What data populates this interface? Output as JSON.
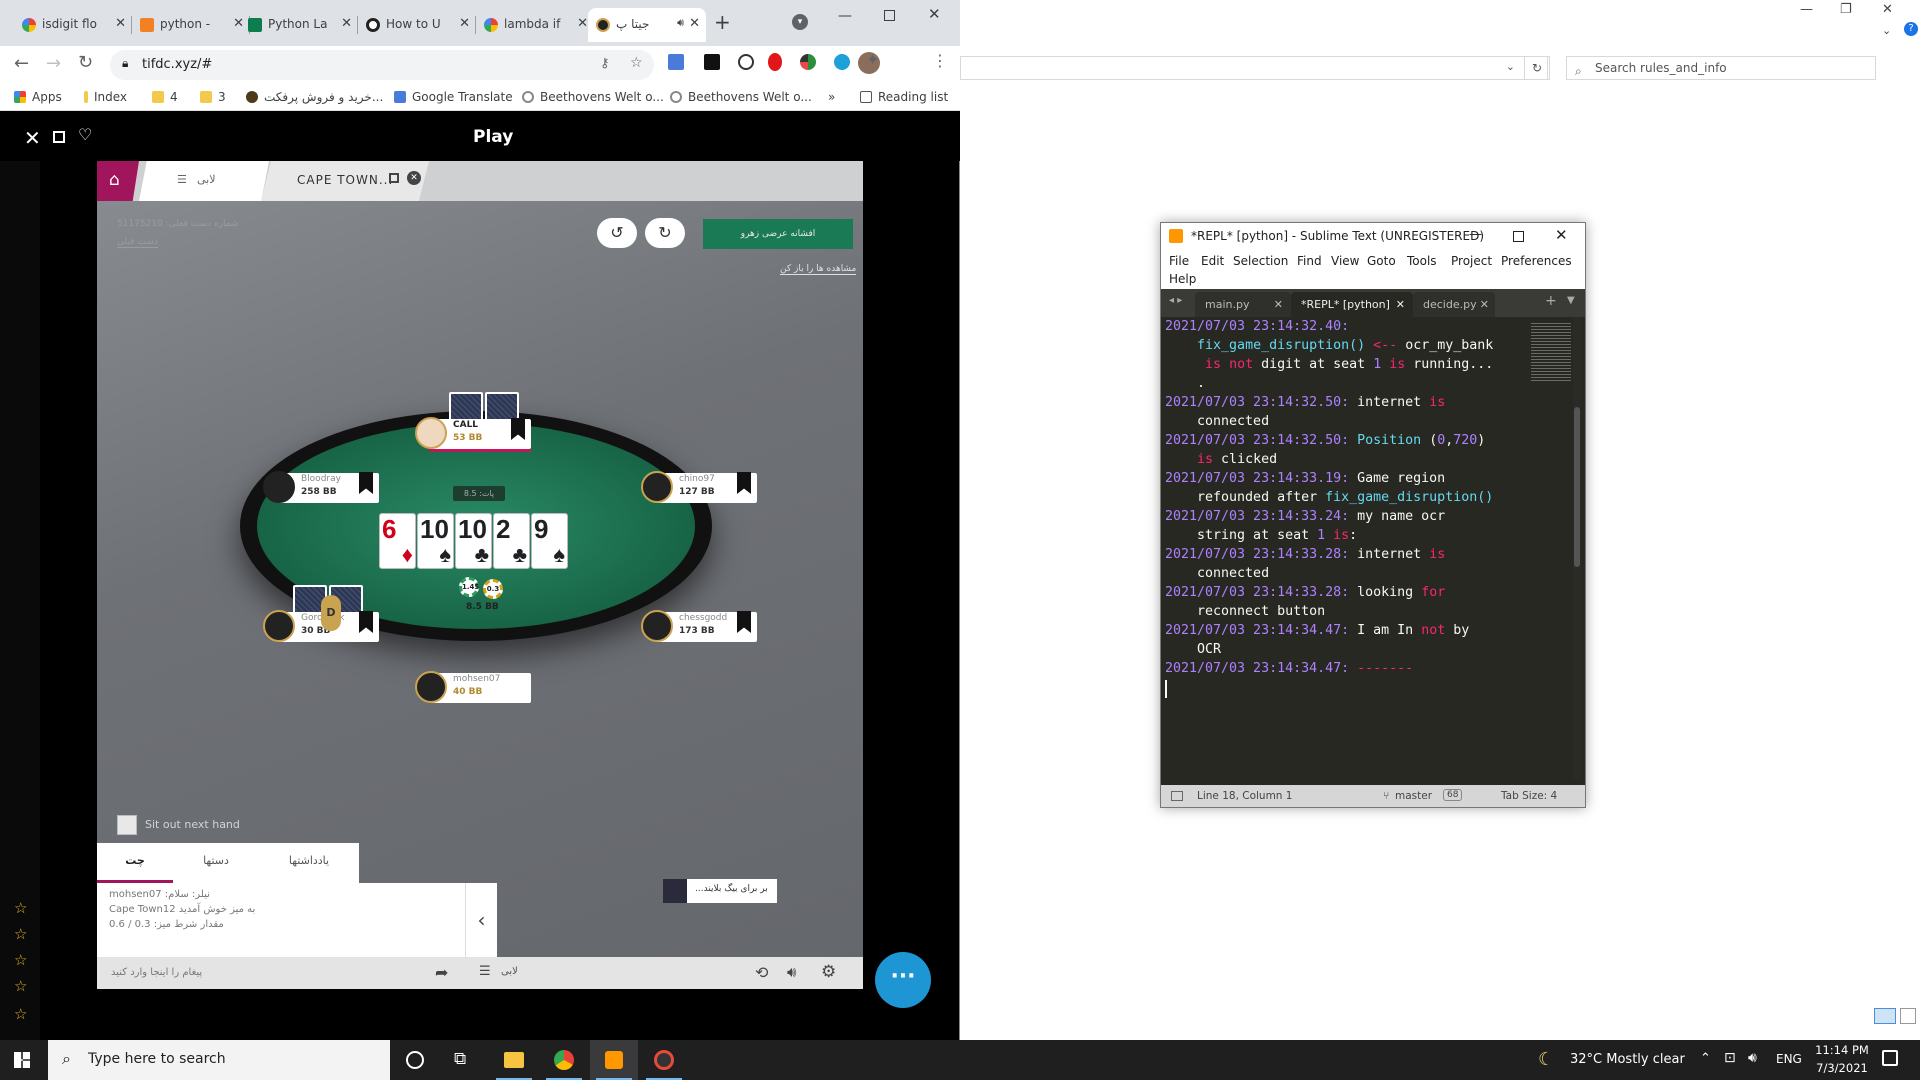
{
  "explorer": {
    "search_placeholder": "Search rules_and_info",
    "minimize": "—",
    "restore": "❐",
    "close": "✕"
  },
  "chrome": {
    "tabs": [
      {
        "label": "isdigit flo"
      },
      {
        "label": "python -"
      },
      {
        "label": "Python La"
      },
      {
        "label": "How to U"
      },
      {
        "label": "lambda if"
      },
      {
        "label": "جیتا پ"
      }
    ],
    "new_tab": "+",
    "url": "tifdc.xyz/#",
    "bookmarks": [
      {
        "label": "Apps"
      },
      {
        "label": "Index"
      },
      {
        "label": "4"
      },
      {
        "label": "3"
      },
      {
        "label": "خرید و فروش پرفکت..."
      },
      {
        "label": "Google Translate"
      },
      {
        "label": "Beethovens Welt o..."
      },
      {
        "label": "Beethovens Welt o..."
      },
      {
        "label": "»"
      },
      {
        "label": "Reading list"
      }
    ]
  },
  "game": {
    "header_title": "Play",
    "tabs": {
      "lobby": "لابی",
      "table": "CAPE TOWN..."
    },
    "rebuy_button": "افشانه عرضی زهرو",
    "view_tables_link": "مشاهده ها را باز کن",
    "top_left_line1": "شماره دست فعلی: 51175210",
    "top_left_line2": "دست قبلی",
    "pot_label": "پات: 8.5",
    "board": [
      {
        "rank": "6",
        "suit": "♦",
        "color": "#d0021b"
      },
      {
        "rank": "10",
        "suit": "♠",
        "color": "#111"
      },
      {
        "rank": "10",
        "suit": "♣",
        "color": "#111"
      },
      {
        "rank": "2",
        "suit": "♣",
        "color": "#111"
      },
      {
        "rank": "9",
        "suit": "♠",
        "color": "#111"
      }
    ],
    "chips": {
      "left": "1.45",
      "right": "0.3",
      "total": "8.5 BB"
    },
    "dealer": "D",
    "seats": {
      "top": {
        "name": "CALL",
        "stack": "53 BB"
      },
      "upper_left": {
        "name": "Bloodray",
        "stack": "258 BB"
      },
      "upper_right": {
        "name": "chino97",
        "stack": "127 BB"
      },
      "lower_left": {
        "name": "Gorodnyk",
        "stack": "30 BB"
      },
      "lower_right": {
        "name": "chessgodd",
        "stack": "173 BB"
      },
      "bottom": {
        "name": "mohsen07",
        "stack": "40 BB"
      }
    },
    "sit_out_label": "Sit out next hand",
    "chat_tabs": [
      "چت",
      "دستها",
      "یادداشتها"
    ],
    "chat_lines": [
      "mohsen07 :نیلر: سلام",
      "Cape Town12 به میز خوش آمدید",
      "0.6 / 0.3 :مقدار شرط میز"
    ],
    "big_blind_label": "...بر برای بیگ بلایند",
    "message_placeholder": "پیغام را اینجا وارد کنید",
    "footer_lobby": "لابی"
  },
  "sublime": {
    "title": "*REPL* [python] - Sublime Text (UNREGISTERED)",
    "menu": [
      "File",
      "Edit",
      "Selection",
      "Find",
      "View",
      "Goto",
      "Tools",
      "Project",
      "Preferences",
      "Help"
    ],
    "tabs": [
      "main.py",
      "*REPL* [python]",
      "decide.py"
    ],
    "code": [
      "2021/07/03 23:14:32.40:",
      "    fix_game_disruption() <-- ocr_my_bank",
      "     is not digit at seat 1 is running...",
      "    .",
      "2021/07/03 23:14:32.50: internet is",
      "    connected",
      "2021/07/03 23:14:32.50: Position (0,720)",
      "    is clicked",
      "2021/07/03 23:14:33.19: Game region",
      "    refounded after fix_game_disruption()",
      "2021/07/03 23:14:33.24: my name ocr",
      "    string at seat 1 is:",
      "2021/07/03 23:14:33.28: internet is",
      "    connected",
      "2021/07/03 23:14:33.28: looking for",
      "    reconnect button",
      "2021/07/03 23:14:34.47: I am In not by",
      "    OCR",
      "2021/07/03 23:14:34.47: -------"
    ],
    "status": {
      "position": "Line 18, Column 1",
      "branch": "master",
      "branch_count": "68",
      "tab_size": "Tab Size: 4"
    }
  },
  "taskbar": {
    "search_placeholder": "Type here to search",
    "weather": "32°C  Mostly clear",
    "lang": "ENG",
    "time": "11:14 PM",
    "date": "7/3/2021"
  }
}
